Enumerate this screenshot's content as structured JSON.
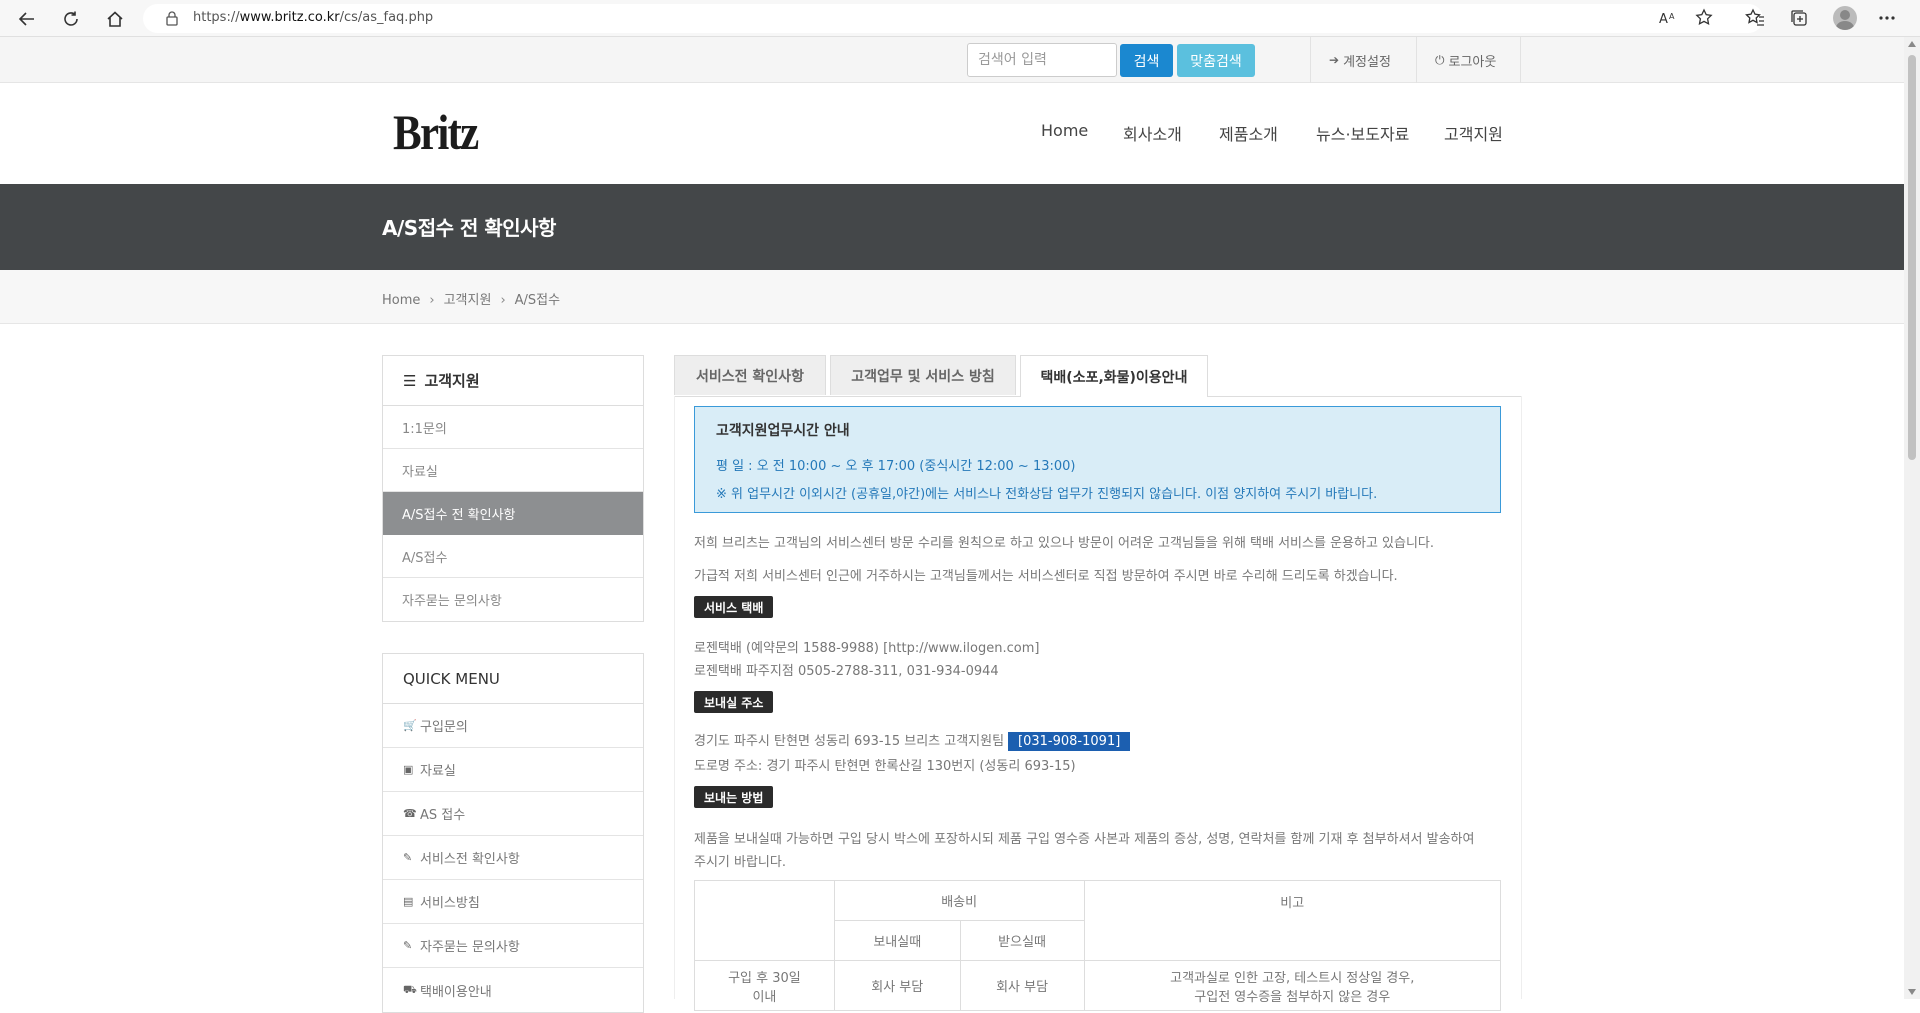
{
  "browser": {
    "url_prefix": "https://",
    "url_host": "www.britz.co.kr",
    "url_path": "/cs/as_faq.php"
  },
  "util": {
    "search_placeholder": "검색어 입력",
    "search_button": "검색",
    "custom_search_button": "맞춤검색",
    "account_settings": "계정설정",
    "logout": "로그아웃"
  },
  "header": {
    "logo": "Britz",
    "nav": [
      "Home",
      "회사소개",
      "제품소개",
      "뉴스·보도자료",
      "고객지원"
    ]
  },
  "page_title": "A/S접수 전 확인사항",
  "breadcrumb": [
    "Home",
    "고객지원",
    "A/S접수"
  ],
  "sidebar": {
    "title": "고객지원",
    "items": [
      "1:1문의",
      "자료실",
      "A/S접수 전 확인사항",
      "A/S접수",
      "자주묻는 문의사항"
    ],
    "active_index": 2
  },
  "quick_menu": {
    "title": "QUICK MENU",
    "items": [
      {
        "label": "구입문의",
        "icon": "cart-icon"
      },
      {
        "label": "자료실",
        "icon": "save-icon"
      },
      {
        "label": "AS 접수",
        "icon": "phone-icon"
      },
      {
        "label": "서비스전 확인사항",
        "icon": "edit-icon"
      },
      {
        "label": "서비스방침",
        "icon": "file-icon"
      },
      {
        "label": "자주묻는 문의사항",
        "icon": "edit-icon"
      },
      {
        "label": "택배이용안내",
        "icon": "truck-icon"
      }
    ]
  },
  "tabs": [
    "서비스전 확인사항",
    "고객업무 및 서비스 방침",
    "택배(소포,화물)이용안내"
  ],
  "active_tab": 2,
  "notice": {
    "title": "고객지원업무시간 안내",
    "line1": "평 일 : 오 전 10:00 ~ 오 후 17:00 (중식시간 12:00 ~ 13:00)",
    "line2": "※ 위 업무시간 이외시간 (공휴일,야간)에는 서비스나 전화상담 업무가 진행되지 않습니다. 이점 양지하여 주시기 바랍니다."
  },
  "intro": {
    "p1": "저희 브리츠는 고객님의 서비스센터 방문 수리를 원칙으로 하고 있으나 방문이 어려운 고객님들을 위해 택배 서비스를 운용하고 있습니다.",
    "p2": "가급적 저희 서비스센터 인근에 거주하시는 고객님들께서는 서비스센터로 직접 방문하여 주시면 바로 수리해 드리도록 하겠습니다."
  },
  "courier": {
    "label": "서비스 택배",
    "line1": "로젠택배 (예약문의 1588-9988) [http://www.ilogen.com]",
    "line2": "로젠택배 파주지점 0505-2788-311, 031-934-0944"
  },
  "address": {
    "label": "보내실 주소",
    "line1": "경기도 파주시 탄현면 성동리 693-15 브리츠 고객지원팀",
    "phone": "[031-908-1091]",
    "line2": "도로명 주소: 경기 파주시 탄현면 한록산길 130번지 (성동리 693-15)"
  },
  "method": {
    "label": "보내는 방법",
    "line1": "제품을 보내실때 가능하면 구입 당시 박스에 포장하시되 제품 구입 영수증 사본과 제품의 증상, 성명, 연락처를 함께 기재 후 첨부하셔서 발송하여",
    "line2": "주시기 바랍니다."
  },
  "table": {
    "shipping_header": "배송비",
    "note_header": "비고",
    "send_header": "보내실때",
    "receive_header": "받으실때",
    "row1": {
      "period_l1": "구입 후 30일",
      "period_l2": "이내",
      "send": "회사 부담",
      "receive": "회사 부담",
      "note_l1": "고객과실로 인한 고장, 테스트시 정상일 경우,",
      "note_l2": "구입전 영수증을 첨부하지 않은 경우"
    }
  }
}
